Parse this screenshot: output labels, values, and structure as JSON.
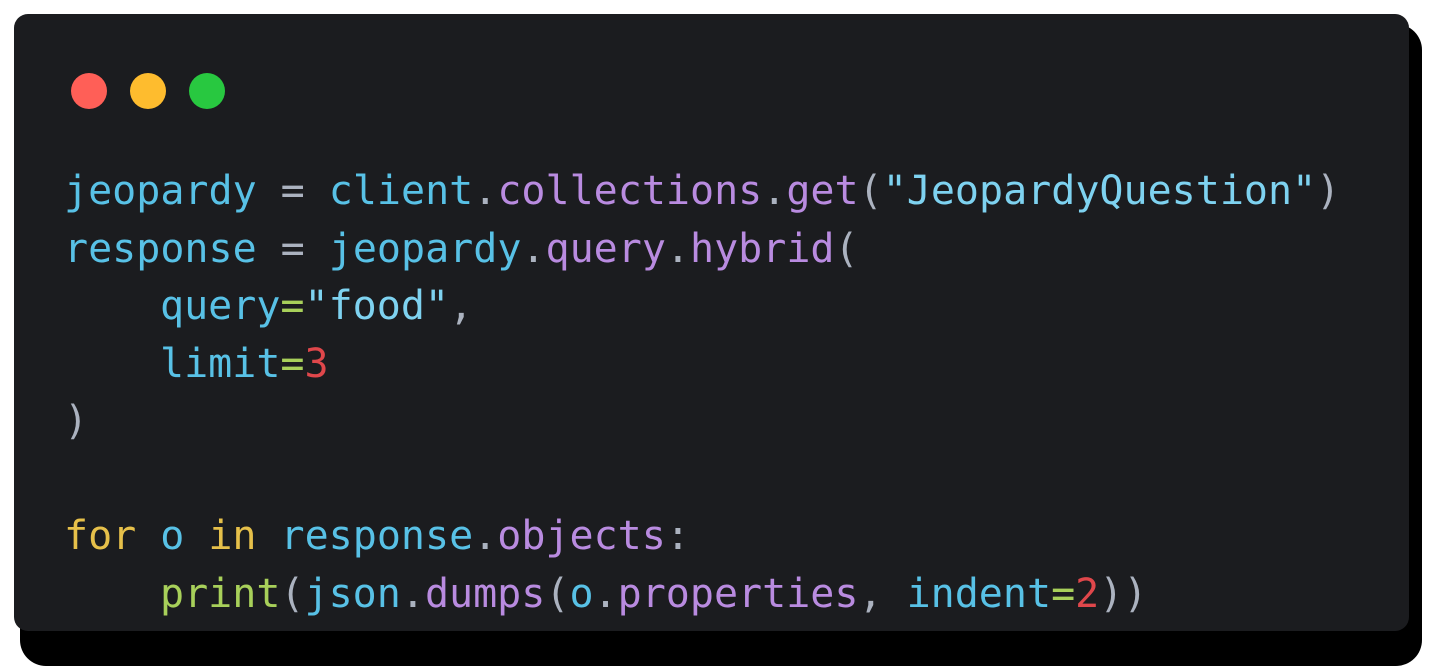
{
  "window": {
    "buttons": [
      {
        "name": "close",
        "color": "#ff5f57"
      },
      {
        "name": "minimize",
        "color": "#febc2e"
      },
      {
        "name": "maximize",
        "color": "#28c840"
      }
    ]
  },
  "colors": {
    "background": "#1b1c1f",
    "variable": "#58c1e6",
    "method": "#b98be0",
    "string": "#7ed2f0",
    "keyword": "#e6c04a",
    "function": "#a8d05a",
    "number": "#e0474b",
    "punctuation": "#abb2bf",
    "operator": "#a8d05a"
  },
  "code": {
    "line1": {
      "var": "jeopardy",
      "op": "=",
      "obj": "client",
      "dot1": ".",
      "attr": "collections",
      "dot2": ".",
      "method": "get",
      "lparen": "(",
      "str": "\"JeopardyQuestion\"",
      "rparen": ")"
    },
    "line2": {
      "var": "response",
      "op": "=",
      "obj": "jeopardy",
      "dot1": ".",
      "attr": "query",
      "dot2": ".",
      "method": "hybrid",
      "lparen": "("
    },
    "line3": {
      "kw": "query",
      "eq": "=",
      "str": "\"food\"",
      "comma": ","
    },
    "line4": {
      "kw": "limit",
      "eq": "=",
      "num": "3"
    },
    "line5": {
      "rparen": ")"
    },
    "line7": {
      "for": "for",
      "var": "o",
      "in": "in",
      "obj": "response",
      "dot": ".",
      "attr": "objects",
      "colon": ":"
    },
    "line8": {
      "fn": "print",
      "lparen1": "(",
      "obj": "json",
      "dot1": ".",
      "method": "dumps",
      "lparen2": "(",
      "o": "o",
      "dot2": ".",
      "attr": "properties",
      "comma": ",",
      "kw": "indent",
      "eq": "=",
      "num": "2",
      "rparens": "))"
    }
  }
}
